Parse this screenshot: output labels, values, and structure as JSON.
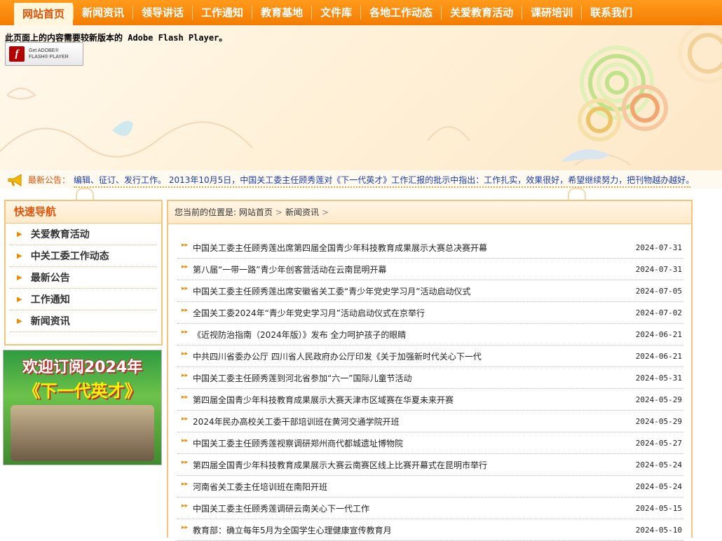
{
  "nav": {
    "items": [
      {
        "label": "网站首页",
        "active": true
      },
      {
        "label": "新闻资讯"
      },
      {
        "label": "领导讲话"
      },
      {
        "label": "工作通知"
      },
      {
        "label": "教育基地"
      },
      {
        "label": "文件库"
      },
      {
        "label": "各地工作动态"
      },
      {
        "label": "关爱教育活动"
      },
      {
        "label": "课研培训"
      },
      {
        "label": "联系我们"
      }
    ]
  },
  "banner": {
    "flash_notice": "此页面上的内容需要较新版本的 Adobe Flash Player。",
    "flash_button_line1": "Get ADOBE®",
    "flash_button_line2": "FLASH® PLAYER",
    "flash_logo_glyph": "f"
  },
  "ticker": {
    "label": "最新公告：",
    "text": "编辑、征订、发行工作。 2013年10月5日，中国关工委主任顾秀莲对《下一代英才》工作汇报的批示中指出：工作扎实，效果很好，希望继续努力，把刊物越办越好。"
  },
  "sidebar": {
    "title": "快速导航",
    "items": [
      "关爱教育活动",
      "中关工委工作动态",
      "最新公告",
      "工作通知",
      "新闻资讯"
    ]
  },
  "promo": {
    "line1": "欢迎订阅2024年",
    "line2": "《下一代英才》"
  },
  "breadcrumb": {
    "prefix": "您当前的位置是:",
    "home": "网站首页",
    "current": "新闻资讯"
  },
  "news": [
    {
      "title": "中国关工委主任顾秀莲出席第四届全国青少年科技教育成果展示大赛总决赛开幕",
      "date": "2024-07-31"
    },
    {
      "title": "第八届“一带一路”青少年创客营活动在云南昆明开幕",
      "date": "2024-07-31"
    },
    {
      "title": "中国关工委主任顾秀莲出席安徽省关工委“青少年党史学习月”活动启动仪式",
      "date": "2024-07-05"
    },
    {
      "title": "全国关工委2024年“青少年党史学习月”活动启动仪式在京举行",
      "date": "2024-07-02"
    },
    {
      "title": "《近视防治指南（2024年版）》发布 全力呵护孩子的眼睛",
      "date": "2024-06-21"
    },
    {
      "title": "中共四川省委办公厅 四川省人民政府办公厅印发《关于加强新时代关心下一代",
      "date": "2024-06-21"
    },
    {
      "title": "中国关工委主任顾秀莲到河北省参加“六一”国际儿童节活动",
      "date": "2024-05-31"
    },
    {
      "title": "第四届全国青少年科技教育成果展示大赛天津市区域赛在华夏未来开赛",
      "date": "2024-05-29"
    },
    {
      "title": "2024年民办高校关工委干部培训班在黄河交通学院开班",
      "date": "2024-05-29"
    },
    {
      "title": "中国关工委主任顾秀莲视察调研郑州商代都城遗址博物院",
      "date": "2024-05-27"
    },
    {
      "title": "第四届全国青少年科技教育成果展示大赛云南赛区线上比赛开幕式在昆明市举行",
      "date": "2024-05-24"
    },
    {
      "title": "河南省关工委主任培训班在南阳开班",
      "date": "2024-05-24"
    },
    {
      "title": "中国关工委主任顾秀莲调研云南关心下一代工作",
      "date": "2024-05-15"
    },
    {
      "title": "教育部：确立每年5月为全国学生心理健康宣传教育月",
      "date": "2024-05-10"
    }
  ]
}
